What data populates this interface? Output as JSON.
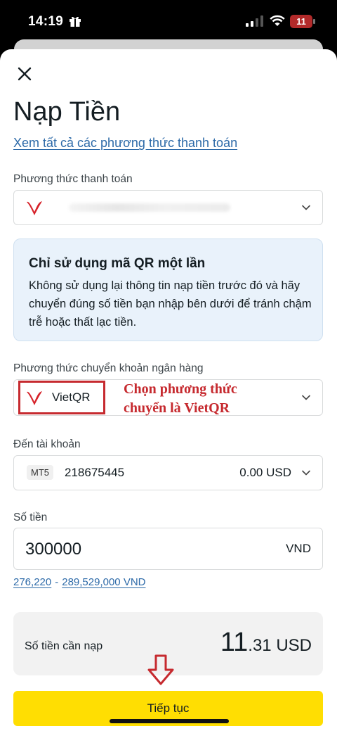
{
  "status_bar": {
    "time": "14:19",
    "battery": "11",
    "icons": [
      "gift-icon",
      "signal-icon",
      "wifi-icon",
      "battery-icon"
    ]
  },
  "header": {
    "title": "Nạp Tiền",
    "all_methods_link": "Xem tất cả các phương thức thanh toán"
  },
  "payment_method": {
    "label": "Phương thức thanh toán"
  },
  "info_box": {
    "title": "Chỉ sử dụng mã QR một lần",
    "body": "Không sử dụng lại thông tin nạp tiền trước đó và hãy chuyển đúng số tiền bạn nhập bên dưới để tránh chậm trễ hoặc thất lạc tiền."
  },
  "bank_transfer": {
    "label": "Phương thức chuyển khoản ngân hàng",
    "selected": "VietQR",
    "annotation_line1": "Chọn phương thức",
    "annotation_line2": "chuyển là VietQR"
  },
  "account": {
    "label": "Đến tài khoản",
    "badge": "MT5",
    "number": "218675445",
    "balance": "0.00 USD"
  },
  "amount": {
    "label": "Số tiền",
    "value": "300000",
    "currency": "VND",
    "range_min": "276,220",
    "range_sep": "-",
    "range_max": "289,529,000 VND"
  },
  "summary": {
    "label": "Số tiền cần nạp",
    "amount_int": "11",
    "amount_dec": ".31",
    "amount_cur": " USD"
  },
  "footer": {
    "continue_label": "Tiếp tục"
  },
  "colors": {
    "accent_yellow": "#ffde02",
    "link_blue": "#2d6aa8",
    "annotation_red": "#c62a2f",
    "info_bg": "#e9f2fb"
  }
}
